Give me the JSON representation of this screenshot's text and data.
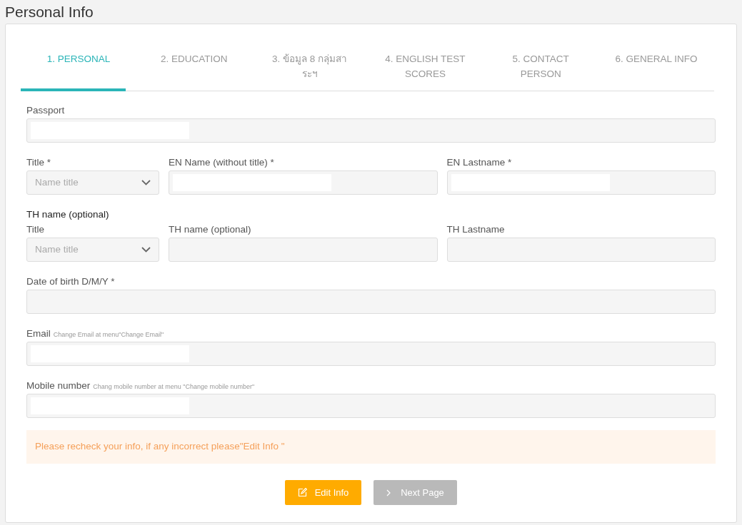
{
  "page": {
    "title": "Personal Info"
  },
  "tabs": [
    {
      "label": "1. PERSONAL",
      "selected": true
    },
    {
      "label": "2. EDUCATION",
      "selected": false
    },
    {
      "label": "3. ข้อมูล 8 กลุ่มสาระฯ",
      "selected": false
    },
    {
      "label": "4. ENGLISH TEST SCORES",
      "selected": false
    },
    {
      "label": "5. CONTACT PERSON",
      "selected": false
    },
    {
      "label": "6. GENERAL INFO",
      "selected": false
    }
  ],
  "sections": [
    {
      "fields": [
        {
          "kind": "text",
          "label": "Passport",
          "redacted": true
        }
      ]
    },
    {
      "fields": [
        {
          "kind": "select",
          "label": "Title *",
          "placeholder": "Name title"
        },
        {
          "kind": "text",
          "label": "EN Name (without title) *",
          "redacted": true
        },
        {
          "kind": "text",
          "label": "EN Lastname *",
          "redacted": true
        }
      ]
    },
    {
      "heading": "TH name (optional)",
      "fields": [
        {
          "kind": "select",
          "label": "Title",
          "placeholder": "Name title"
        },
        {
          "kind": "text",
          "label": "TH name (optional)",
          "redacted": false
        },
        {
          "kind": "text",
          "label": "TH Lastname",
          "redacted": false
        }
      ]
    },
    {
      "fields": [
        {
          "kind": "text",
          "label": "Date of birth D/M/Y *",
          "redacted": false
        }
      ]
    },
    {
      "fields": [
        {
          "kind": "text",
          "label": "Email",
          "hint": "Change Email at menu\"Change Email\"",
          "redacted": true
        }
      ]
    },
    {
      "fields": [
        {
          "kind": "text",
          "label": "Mobile number",
          "hint": "Chang mobile number at menu \"Change mobile number\"",
          "redacted": true
        }
      ]
    }
  ],
  "alert": "Please recheck your info, if any incorrect please\"Edit Info \"",
  "buttons": [
    {
      "kind": "edit",
      "label": "Edit Info"
    },
    {
      "kind": "next",
      "label": "Next Page"
    }
  ]
}
